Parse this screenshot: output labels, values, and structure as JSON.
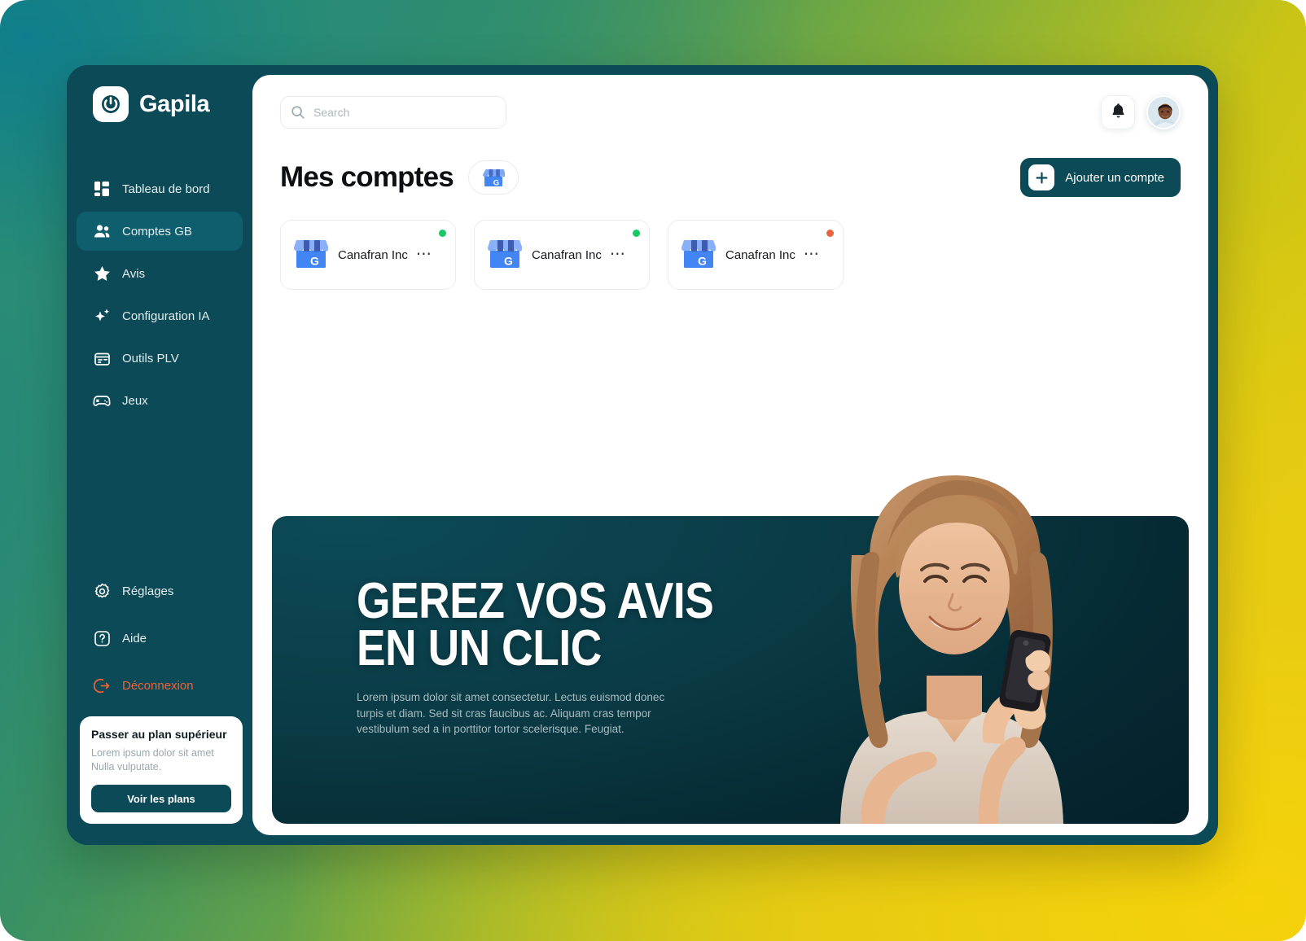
{
  "brand": {
    "name": "Gapila",
    "logo_icon": "gapila-power-logo"
  },
  "sidebar": {
    "items": [
      {
        "label": "Tableau de bord",
        "icon": "dashboard-icon",
        "active": false
      },
      {
        "label": "Comptes GB",
        "icon": "users-icon",
        "active": true
      },
      {
        "label": "Avis",
        "icon": "star-icon",
        "active": false
      },
      {
        "label": "Configuration IA",
        "icon": "sparkle-icon",
        "active": false
      },
      {
        "label": "Outils PLV",
        "icon": "storefront-icon",
        "active": false
      },
      {
        "label": "Jeux",
        "icon": "gamepad-icon",
        "active": false
      }
    ],
    "bottom_items": [
      {
        "label": "Réglages",
        "icon": "gear-icon",
        "danger": false
      },
      {
        "label": "Aide",
        "icon": "help-icon",
        "danger": false
      },
      {
        "label": "Déconnexion",
        "icon": "logout-icon",
        "danger": true
      }
    ],
    "upgrade_card": {
      "title": "Passer au plan supérieur",
      "description": "Lorem ipsum dolor sit amet Nulla vulputate.",
      "button_label": "Voir les plans"
    }
  },
  "topbar": {
    "search_placeholder": "Search",
    "search_value": "",
    "search_icon": "search-icon",
    "bell_icon": "bell-icon",
    "avatar_icon": "user-avatar"
  },
  "page": {
    "title": "Mes comptes",
    "badge_icon": "google-business-profile-icon",
    "add_button_label": "Ajouter un compte",
    "add_button_icon": "plus-icon"
  },
  "accounts": [
    {
      "name": "Canafran Inc",
      "icon": "google-business-storefront-icon",
      "status_color": "#17c964",
      "menu_icon": "ellipsis-icon"
    },
    {
      "name": "Canafran Inc",
      "icon": "google-business-storefront-icon",
      "status_color": "#17c964",
      "menu_icon": "ellipsis-icon"
    },
    {
      "name": "Canafran Inc",
      "icon": "google-business-storefront-icon",
      "status_color": "#e8643c",
      "menu_icon": "ellipsis-icon"
    }
  ],
  "hero": {
    "title": "GEREZ VOS AVIS\nEN UN CLIC",
    "subtitle": "Lorem ipsum dolor sit amet consectetur. Lectus euismod donec turpis et diam. Sed sit cras faucibus ac. Aliquam cras tempor vestibulum sed a in porttitor tortor scelerisque. Feugiat.",
    "image_alt": "smiling-woman-with-smartphone"
  },
  "colors": {
    "brand_dark": "#0b4a56",
    "sidebar_active": "#0f5e6d",
    "danger": "#f0623a",
    "status_online": "#17c964",
    "status_warning": "#e8643c",
    "google_blue": "#4285f4"
  }
}
